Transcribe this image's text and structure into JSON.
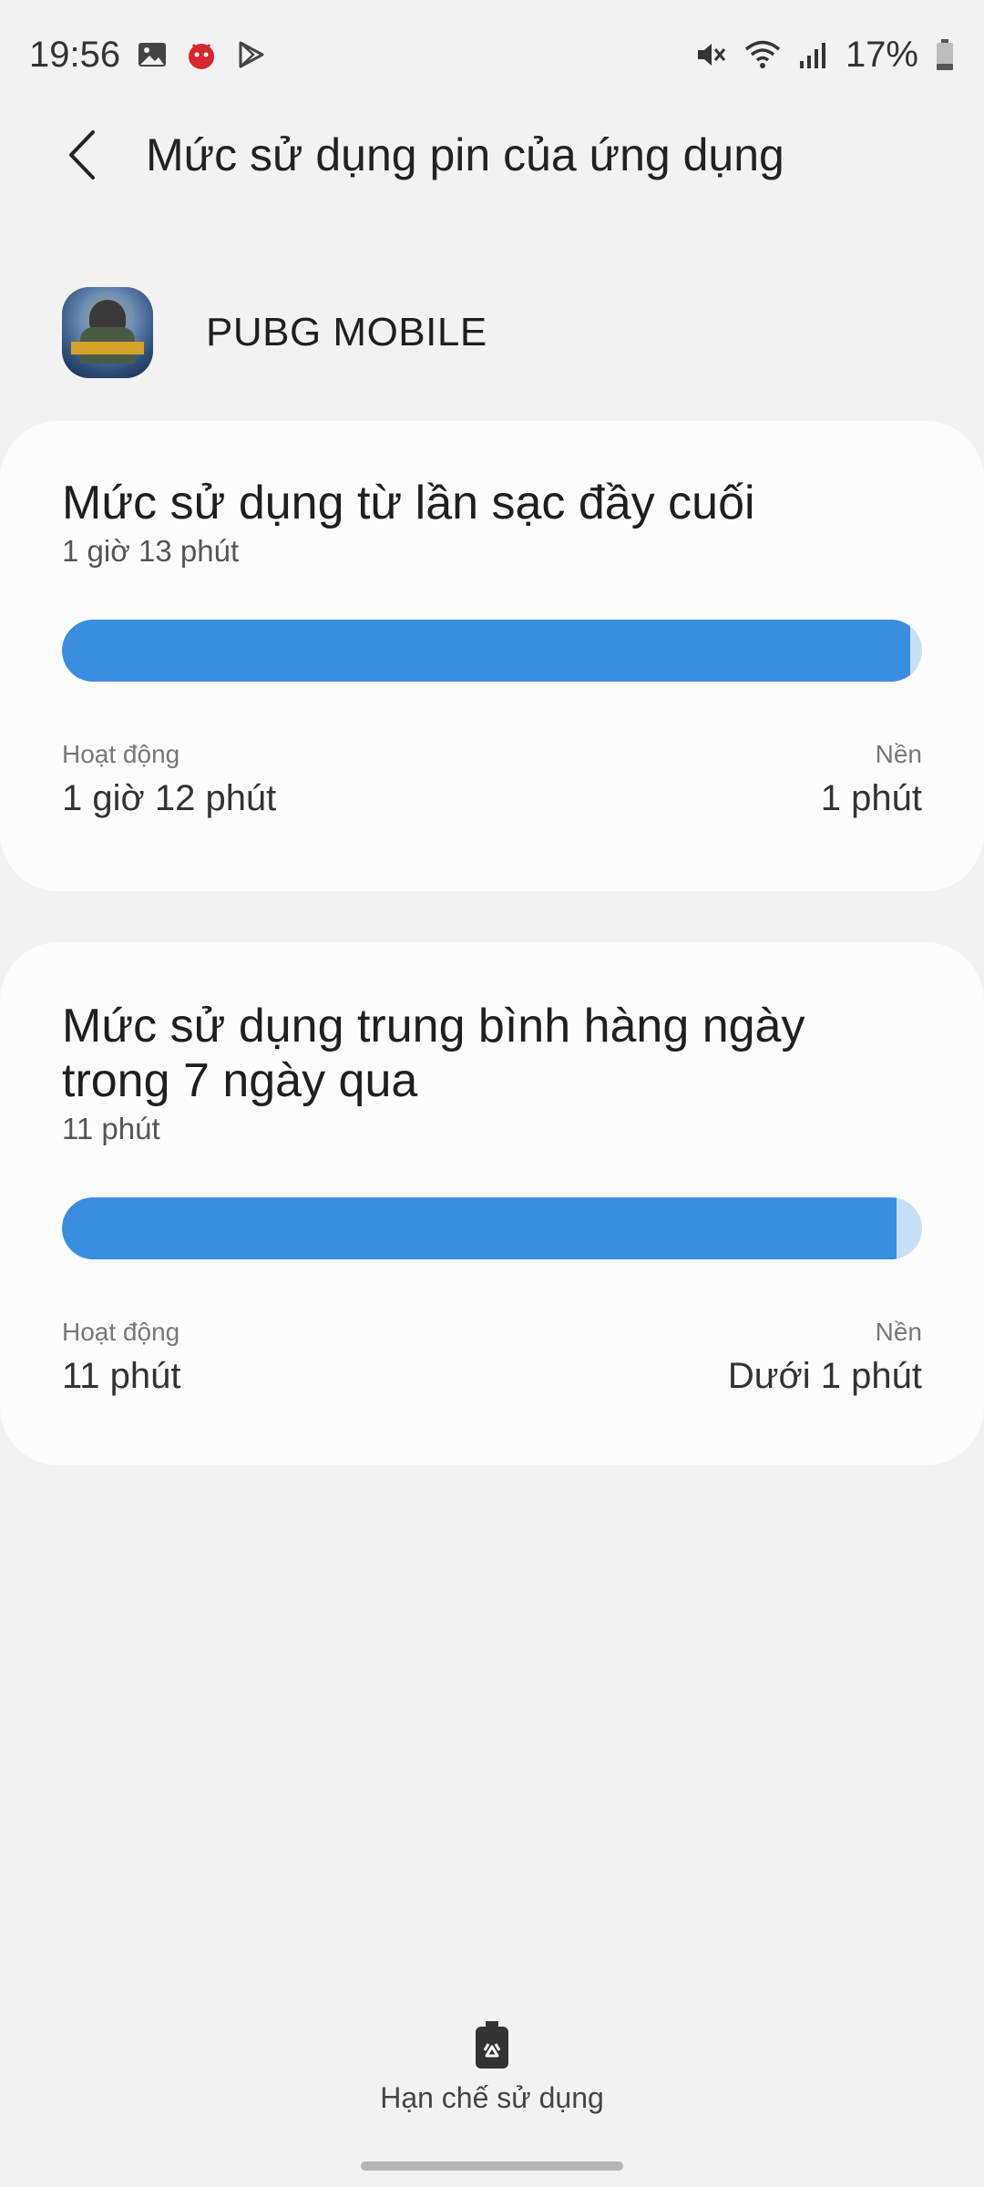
{
  "status_bar": {
    "time": "19:56",
    "battery_percent": "17%",
    "left_icons": [
      "gallery-icon",
      "antutu-icon",
      "play-store-icon"
    ],
    "right_icons": [
      "mute-icon",
      "wifi-icon",
      "signal-icon",
      "battery-icon"
    ]
  },
  "header": {
    "title": "Mức sử dụng pin của ứng dụng"
  },
  "app": {
    "name": "PUBG MOBILE"
  },
  "since_charge": {
    "title": "Mức sử dụng từ lần sạc đầy cuối",
    "total": "1 giờ 13 phút",
    "active_label": "Hoạt động",
    "active_value": "1 giờ 12 phút",
    "background_label": "Nền",
    "background_value": "1 phút",
    "active_fraction": 0.986
  },
  "daily_average": {
    "title": "Mức sử dụng trung bình hàng ngày trong 7 ngày qua",
    "total": "11 phút",
    "active_label": "Hoạt động",
    "active_value": "11 phút",
    "background_label": "Nền",
    "background_value": "Dưới 1 phút",
    "active_fraction": 0.97
  },
  "bottom_action": {
    "label": "Hạn chế sử dụng",
    "icon": "battery-restrict-icon"
  },
  "colors": {
    "bar_active": "#3a8ee0",
    "bar_background": "#c8def5",
    "page_background": "#f2f2f2",
    "card_background": "#fcfcfc"
  }
}
